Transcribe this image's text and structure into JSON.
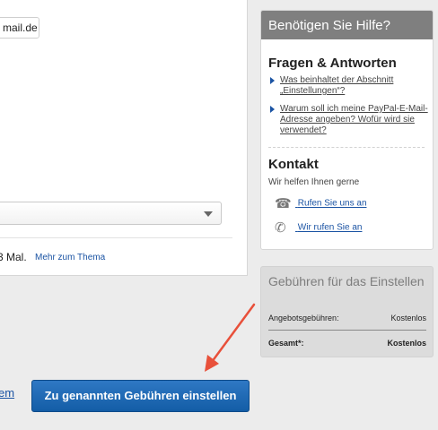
{
  "main": {
    "email_value": "mail.de",
    "select_value": "",
    "times_text": "3 Mal.",
    "more_link": "Mehr zum Thema"
  },
  "help": {
    "title": "Benötigen Sie Hilfe?",
    "faq_title": "Fragen & Antworten",
    "faq_items": [
      "Was beinhaltet der Abschnitt „Einstellungen“?",
      "Warum soll ich meine PayPal-E-Mail-Adresse angeben? Wofür wird sie verwendet?"
    ],
    "contact_title": "Kontakt",
    "contact_sub": "Wir helfen Ihnen gerne",
    "contact_links": [
      {
        "label": "Rufen Sie uns an",
        "icon": "phone-icon"
      },
      {
        "label": "Wir rufen Sie an",
        "icon": "callback-icon"
      }
    ]
  },
  "fees": {
    "title": "Gebühren für das Einstellen",
    "rows": [
      {
        "label": "Angebotsgebühren:",
        "value": "Kostenlos"
      },
      {
        "label": "Gesamt*:",
        "value": "Kostenlos"
      }
    ]
  },
  "footer": {
    "left_link": "em",
    "submit_label": "Zu genannten Gebühren einstellen"
  },
  "colors": {
    "accent": "#1a53a3",
    "button": "#135da6",
    "arrow": "#e8503a",
    "help_header": "#7f7f7f"
  }
}
